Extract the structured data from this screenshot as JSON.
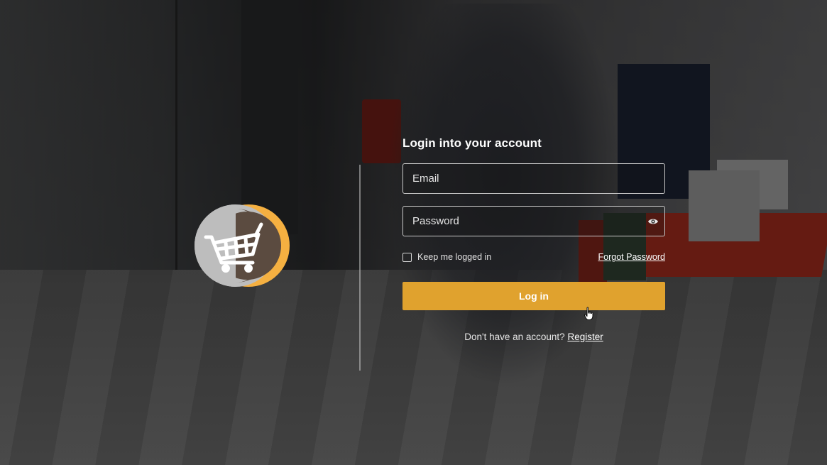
{
  "login": {
    "title": "Login into your account",
    "email_placeholder": "Email",
    "password_placeholder": "Password",
    "keep_logged_in_label": "Keep me logged in",
    "keep_logged_in_checked": false,
    "forgot_password_label": "Forgot Password",
    "login_button_label": "Log in",
    "no_account_text": "Don't have an account?",
    "register_label": "Register"
  },
  "icons": {
    "logo": "shopping-cart-moon-logo",
    "password_toggle": "eye-icon",
    "cursor": "hand-pointer-cursor"
  },
  "colors": {
    "accent": "#e0a22e",
    "logo_circle": "#bdbdbd",
    "logo_moon": "#f5b041",
    "text": "#ffffff"
  }
}
